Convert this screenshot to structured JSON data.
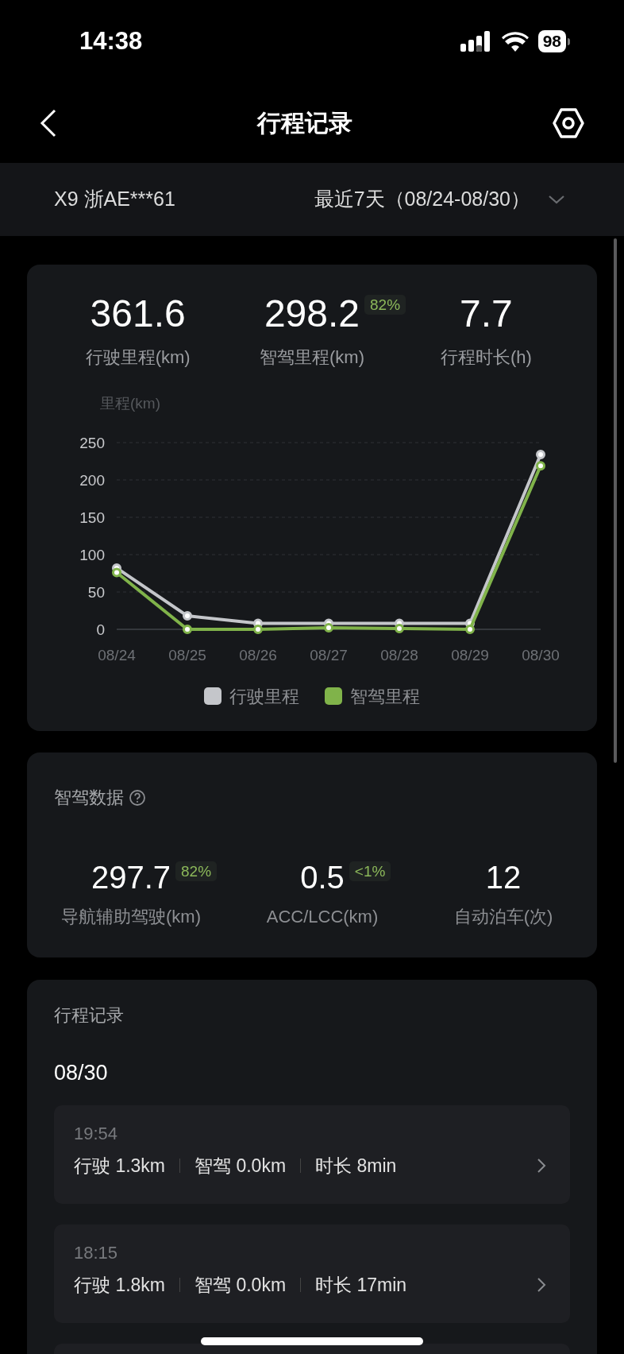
{
  "status_bar": {
    "time": "14:38",
    "battery": "98"
  },
  "nav": {
    "title": "行程记录"
  },
  "selector": {
    "vehicle": "X9 浙AE***61",
    "range": "最近7天（08/24-08/30）"
  },
  "summary": {
    "stats": [
      {
        "value": "361.6",
        "label": "行驶里程(km)"
      },
      {
        "value": "298.2",
        "label": "智驾里程(km)",
        "badge": "82%"
      },
      {
        "value": "7.7",
        "label": "行程时长(h)"
      }
    ],
    "chart_data": {
      "type": "line",
      "ylabel": "里程(km)",
      "categories": [
        "08/24",
        "08/25",
        "08/26",
        "08/27",
        "08/28",
        "08/29",
        "08/30"
      ],
      "ylim": [
        0,
        250
      ],
      "grid": true,
      "yticks": [
        0,
        50,
        100,
        150,
        200,
        250
      ],
      "series": [
        {
          "name": "行驶里程",
          "color": "#c4c6ca",
          "marker": "circle",
          "values": [
            82,
            18,
            8,
            8,
            8,
            8,
            234
          ]
        },
        {
          "name": "智驾里程",
          "color": "#80b34a",
          "marker": "circle",
          "values": [
            76,
            0,
            0,
            2,
            1,
            0,
            219
          ]
        }
      ]
    }
  },
  "smart_drive": {
    "title": "智驾数据",
    "stats": [
      {
        "value": "297.7",
        "label": "导航辅助驾驶(km)",
        "badge": "82%"
      },
      {
        "value": "0.5",
        "label": "ACC/LCC(km)",
        "badge": "<1%"
      },
      {
        "value": "12",
        "label": "自动泊车(次)"
      }
    ]
  },
  "trips": {
    "title": "行程记录",
    "date": "08/30",
    "items": [
      {
        "time": "19:54",
        "drive": "行驶 1.3km",
        "smart": "智驾 0.0km",
        "duration": "时长 8min"
      },
      {
        "time": "18:15",
        "drive": "行驶 1.8km",
        "smart": "智驾 0.0km",
        "duration": "时长 17min"
      }
    ]
  }
}
